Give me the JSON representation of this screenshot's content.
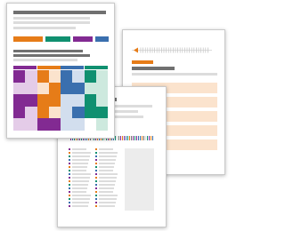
{
  "icon": "documents-stack-icon",
  "colors": {
    "gray": "#707070",
    "gray_light": "#dcdcdc",
    "orange": "#e67c18",
    "orange_light": "#fbe3cd",
    "green": "#109070",
    "green_light": "#cde9de",
    "purple": "#822a92",
    "purple_light": "#e4cce8",
    "blue": "#3a6fae",
    "blue_light": "#d2deee"
  }
}
